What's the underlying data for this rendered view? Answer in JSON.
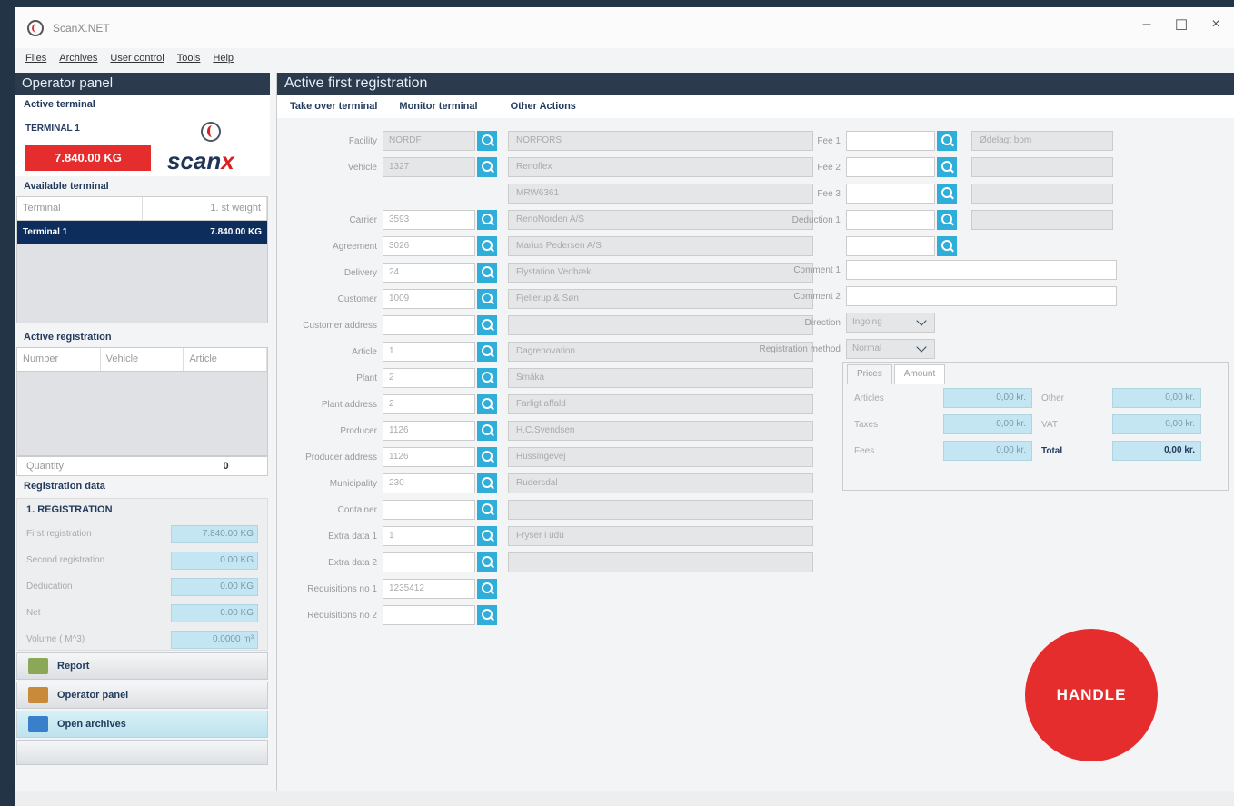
{
  "window": {
    "title": "ScanX.NET",
    "min": "–",
    "max": "☐",
    "close": "×"
  },
  "menu": [
    "Files",
    "Archives",
    "User control",
    "Tools",
    "Help"
  ],
  "left": {
    "header": "Operator panel",
    "active_terminal_label": "Active terminal",
    "terminal_name": "TERMINAL 1",
    "terminal_weight": "7.840.00 KG",
    "logo_text": "scan",
    "logo_x": "x",
    "available_label": "Available terminal",
    "terminal_cols": [
      "Terminal",
      "1. st weight"
    ],
    "terminal_row": [
      "Terminal 1",
      "7.840.00 KG"
    ],
    "active_reg_label": "Active registration",
    "reg_cols": [
      "Number",
      "Vehicle",
      "Article"
    ],
    "quantity_label": "Quantity",
    "quantity_value": "0",
    "regdata_label": "Registration data",
    "reg_title": "1. REGISTRATION",
    "reg_rows": [
      {
        "label": "First registration",
        "value": "7.840.00 KG"
      },
      {
        "label": "Second registration",
        "value": "0.00 KG"
      },
      {
        "label": "Deducation",
        "value": "0.00 KG"
      },
      {
        "label": "Net",
        "value": "0.00 KG"
      },
      {
        "label": "Volume ( M^3)",
        "value": "0.0000 m³"
      }
    ],
    "nav": [
      "Report",
      "Operator panel",
      "Open archives"
    ]
  },
  "main": {
    "header": "Active first registration",
    "actions": [
      "Take over terminal",
      "Monitor terminal",
      "Other Actions"
    ],
    "fields": [
      {
        "label": "Facility",
        "value": "NORDF",
        "desc": "NORFORS",
        "ro": true
      },
      {
        "label": "Vehicle",
        "value": "1327",
        "desc": "Renoflex",
        "ro": true
      },
      {
        "label": "",
        "value": "",
        "desc": "MRW6361",
        "ro": true
      },
      {
        "label": "Carrier",
        "value": "3593",
        "desc": "RenoNorden A/S"
      },
      {
        "label": "Agreement",
        "value": "3026",
        "desc": "Marius Pedersen A/S"
      },
      {
        "label": "Delivery",
        "value": "24",
        "desc": "Flystation Vedbæk"
      },
      {
        "label": "Customer",
        "value": "1009",
        "desc": "Fjellerup & Søn"
      },
      {
        "label": "Customer address",
        "value": "",
        "desc": ""
      },
      {
        "label": "Article",
        "value": "1",
        "desc": "Dagrenovation"
      },
      {
        "label": "Plant",
        "value": "2",
        "desc": "Småka"
      },
      {
        "label": "Plant address",
        "value": "2",
        "desc": "Farligt affald"
      },
      {
        "label": "Producer",
        "value": "1126",
        "desc": "H.C.Svendsen"
      },
      {
        "label": "Producer address",
        "value": "1126",
        "desc": "Hussingevej"
      },
      {
        "label": "Municipality",
        "value": "230",
        "desc": "Rudersdal"
      },
      {
        "label": "Container",
        "value": "",
        "desc": ""
      },
      {
        "label": "Extra data 1",
        "value": "1",
        "desc": "Fryser i udu"
      },
      {
        "label": "Extra data 2",
        "value": "",
        "desc": ""
      },
      {
        "label": "Requisitions no 1",
        "value": "1235412",
        "desc": null
      },
      {
        "label": "Requisitions no 2",
        "value": "",
        "desc": null
      }
    ],
    "fees": [
      {
        "label": "Fee 1",
        "desc": "Ødelagt bom"
      },
      {
        "label": "Fee 2",
        "desc": ""
      },
      {
        "label": "Fee 3",
        "desc": ""
      },
      {
        "label": "Deduction 1",
        "desc": ""
      },
      {
        "label": "",
        "desc": null
      }
    ],
    "comment1": "Comment 1",
    "comment2": "Comment 2",
    "direction_label": "Direction",
    "direction_value": "Ingoing",
    "method_label": "Registration method",
    "method_value": "Normal",
    "tabs": [
      "Prices",
      "Amount"
    ],
    "prices": [
      {
        "l1": "Articles",
        "v1": "0,00 kr.",
        "l2": "Other",
        "v2": "0,00 kr."
      },
      {
        "l1": "Taxes",
        "v1": "0,00 kr.",
        "l2": "VAT",
        "v2": "0,00 kr."
      },
      {
        "l1": "Fees",
        "v1": "0,00 kr.",
        "l2": "Total",
        "v2": "0,00 kr."
      }
    ],
    "handle": "HANDLE"
  }
}
